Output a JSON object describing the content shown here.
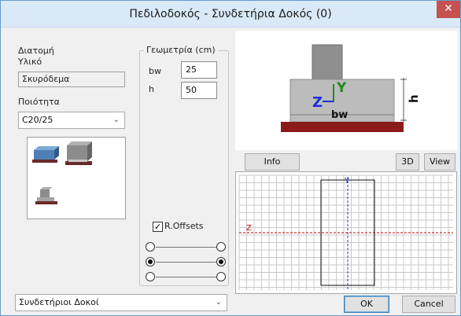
{
  "window": {
    "title": "Πεδιλοδοκός - Συνδετήρια Δοκός (0)",
    "close_glyph": "✕"
  },
  "section": {
    "label": "Διατομή",
    "material_label": "Υλικό",
    "material_value": "Σκυρόδεμα",
    "quality_label": "Ποιότητα",
    "quality_value": "C20/25"
  },
  "geometry": {
    "legend": "Γεωμετρία (cm)",
    "bw_label": "bw",
    "bw_value": "25",
    "h_label": "h",
    "h_value": "50"
  },
  "offsets": {
    "label": "R.Offsets",
    "checked": true
  },
  "preview": {
    "z_label": "Z",
    "y_label": "Y",
    "bw_label": "bw",
    "h_label": "h"
  },
  "toolbar": {
    "info": "Info",
    "view3d": "3D",
    "view": "View"
  },
  "grid": {
    "z_axis": "Z",
    "y_axis": "Y"
  },
  "bottom": {
    "category_value": "Συνδετήριοι Δοκοί",
    "ok": "OK",
    "cancel": "Cancel"
  },
  "colors": {
    "title_bar": "#d9e9f7",
    "close": "#c75050",
    "beam_grey": "#b9b9b9",
    "base_red": "#8b1a1a",
    "axis_z": "#cc0000",
    "axis_y": "#2a2ad0",
    "accent_blue": "#1e2fd8",
    "accent_green": "#1e8c1e"
  }
}
